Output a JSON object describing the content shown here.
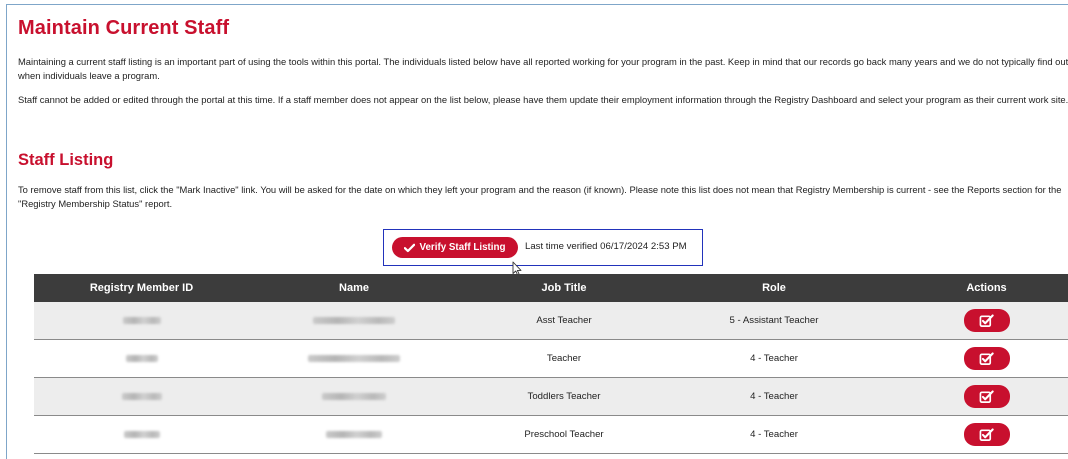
{
  "page": {
    "title": "Maintain Current Staff",
    "intro_1": "Maintaining a current staff listing is an important part of using the tools within this portal. The individuals listed below have all reported working for your program in the past. Keep in mind that our records go back many years and we do not typically find out when individuals leave a program.",
    "intro_2": "Staff cannot be added or edited through the portal at this time. If a staff member does not appear on the list below, please have them update their employment information through the Registry Dashboard and select your program as their current work site."
  },
  "staff_listing": {
    "title": "Staff Listing",
    "instructions": "To remove staff from this list, click the \"Mark Inactive\" link. You will be asked for the date on which they left your program and the reason (if known). Please note this list does not mean that Registry Membership is current - see the Reports section for the \"Registry Membership Status\" report.",
    "verify_button_label": "Verify Staff Listing",
    "last_verified": "Last time verified 06/17/2024 2:53 PM"
  },
  "table": {
    "headers": [
      "Registry Member ID",
      "Name",
      "Job Title",
      "Role",
      "Actions"
    ],
    "rows": [
      {
        "job_title": "Asst Teacher",
        "role": "5 - Assistant Teacher"
      },
      {
        "job_title": "Teacher",
        "role": "4 - Teacher"
      },
      {
        "job_title": "Toddlers Teacher",
        "role": "4 - Teacher"
      },
      {
        "job_title": "Preschool Teacher",
        "role": "4 - Teacher"
      }
    ]
  },
  "icons": {
    "verify": "check-icon",
    "action": "edit-checkbox-icon",
    "cursor": "mouse-pointer-icon"
  },
  "colors": {
    "brand_red": "#c8102e",
    "header_dark": "#3c3c3c",
    "highlight_box": "#2233bb"
  }
}
